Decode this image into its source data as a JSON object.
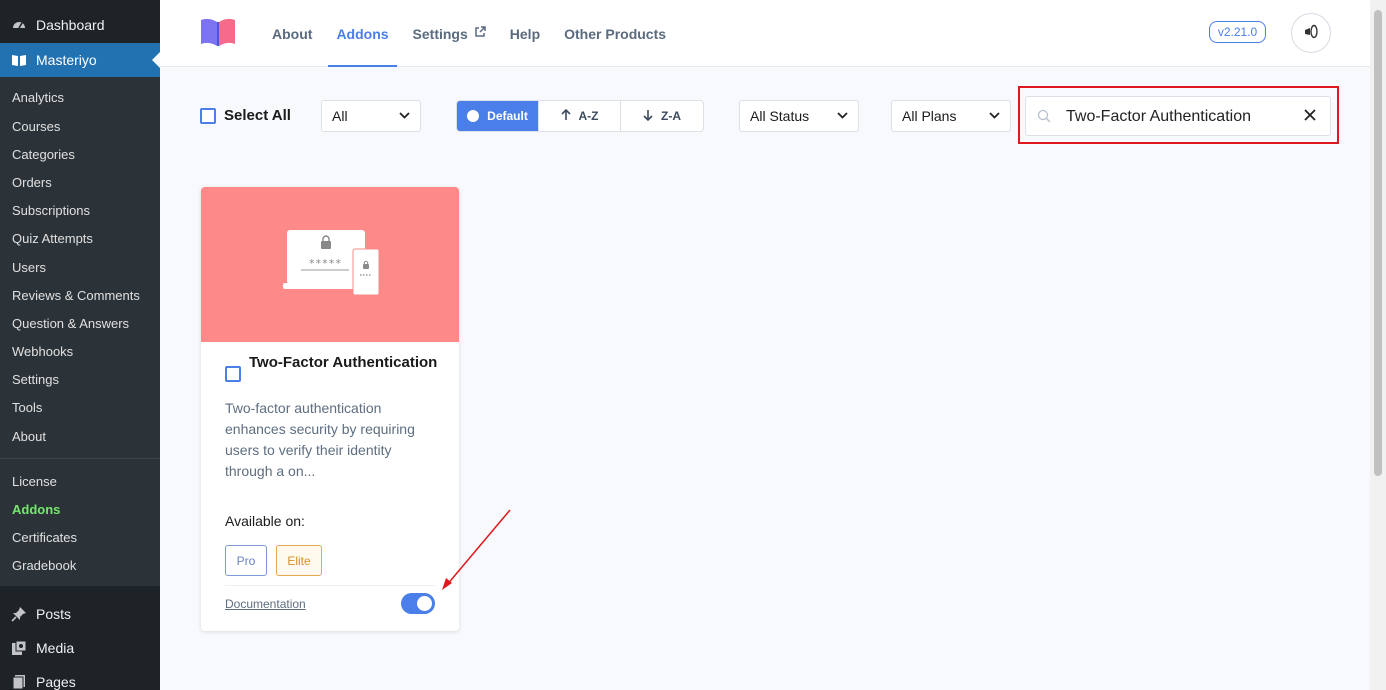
{
  "sidebar": {
    "dashboard": "Dashboard",
    "plugin": "Masteriyo",
    "submenu": [
      "Analytics",
      "Courses",
      "Categories",
      "Orders",
      "Subscriptions",
      "Quiz Attempts",
      "Users",
      "Reviews & Comments",
      "Question & Answers",
      "Webhooks",
      "Settings",
      "Tools",
      "About"
    ],
    "submenu2": [
      "License",
      "Addons",
      "Certificates",
      "Gradebook"
    ],
    "current": "Addons",
    "wp_items": [
      "Posts",
      "Media",
      "Pages"
    ]
  },
  "header": {
    "nav": [
      "About",
      "Addons",
      "Settings",
      "Help",
      "Other Products"
    ],
    "active_nav": "Addons",
    "version": "v2.21.0"
  },
  "filters": {
    "select_all": "Select All",
    "category": "All",
    "sort": [
      "Default",
      "A-Z",
      "Z-A"
    ],
    "sort_selected": "Default",
    "status": "All Status",
    "plans": "All Plans",
    "search_value": "Two-Factor Authentication"
  },
  "addon": {
    "title": "Two-Factor Authentication",
    "description": "Two-factor authentication enhances security by requiring users to verify their identity through a on...",
    "available_label": "Available on:",
    "plans": [
      "Pro",
      "Elite"
    ],
    "doc_link": "Documentation",
    "enabled": true,
    "illustration_text": "*****"
  },
  "colors": {
    "accent": "#4a7ee8",
    "sidebar": "#1d2327",
    "banner": "#fd8a88",
    "highlight": "#e0181e",
    "sidebar_current": "#72e86b"
  }
}
